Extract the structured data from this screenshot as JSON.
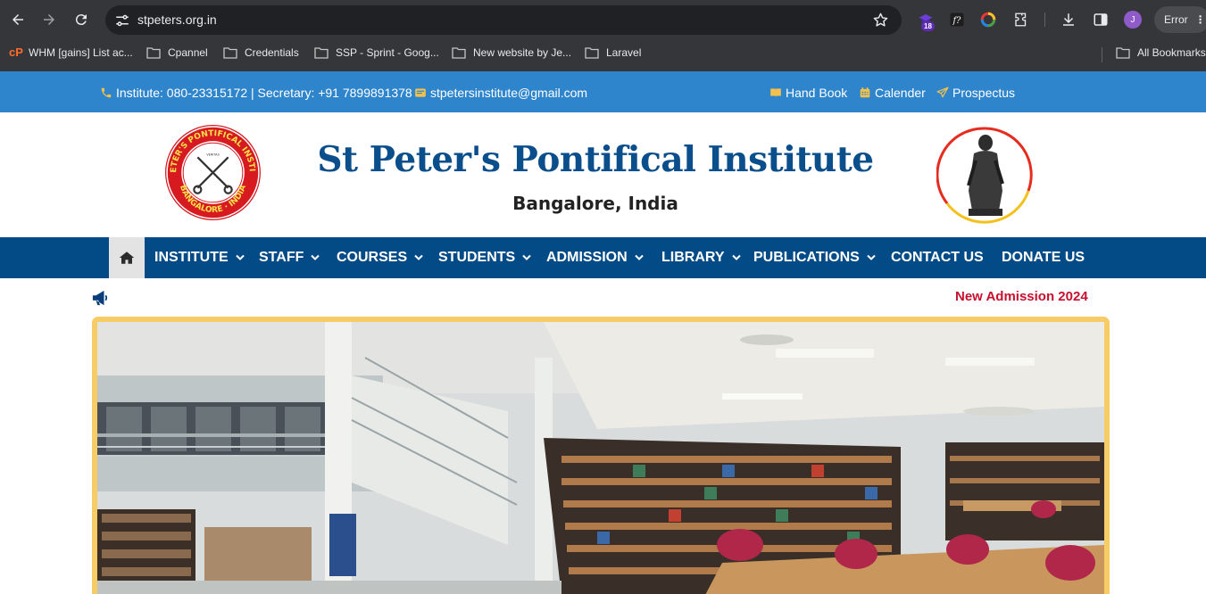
{
  "browser": {
    "url": "stpeters.org.in",
    "extension_badge": "18",
    "profile_initial": "J",
    "error_label": "Error",
    "bookmarks": [
      "WHM [gains] List ac...",
      "Cpannel",
      "Credentials",
      "SSP - Sprint - Goog...",
      "New website by Je...",
      "Laravel"
    ],
    "all_bookmarks": "All Bookmarks"
  },
  "topbar": {
    "contact": "Institute: 080-23315172 | Secretary: +91 7899891378",
    "email": "stpetersinstitute@gmail.com",
    "links": [
      "Hand Book",
      "Calender",
      "Prospectus"
    ]
  },
  "header": {
    "title": "St Peter's Pontifical Institute",
    "subtitle": "Bangalore, India"
  },
  "nav": {
    "items": [
      {
        "label": "INSTITUTE",
        "dropdown": true
      },
      {
        "label": "STAFF",
        "dropdown": true
      },
      {
        "label": "COURSES",
        "dropdown": true
      },
      {
        "label": "STUDENTS",
        "dropdown": true
      },
      {
        "label": "ADMISSION",
        "dropdown": true
      },
      {
        "label": "LIBRARY",
        "dropdown": true
      },
      {
        "label": "PUBLICATIONS",
        "dropdown": true
      },
      {
        "label": "CONTACT US",
        "dropdown": false
      },
      {
        "label": "DONATE US",
        "dropdown": false
      }
    ]
  },
  "ticker": {
    "news": "New Admission 2024"
  },
  "colors": {
    "topbar": "#2e85cc",
    "nav": "#034b87",
    "title": "#0a4e8c",
    "news": "#c8102e",
    "slider_border": "#f7cc66"
  },
  "icons": {
    "home": "home-icon",
    "announcement": "megaphone-icon"
  }
}
